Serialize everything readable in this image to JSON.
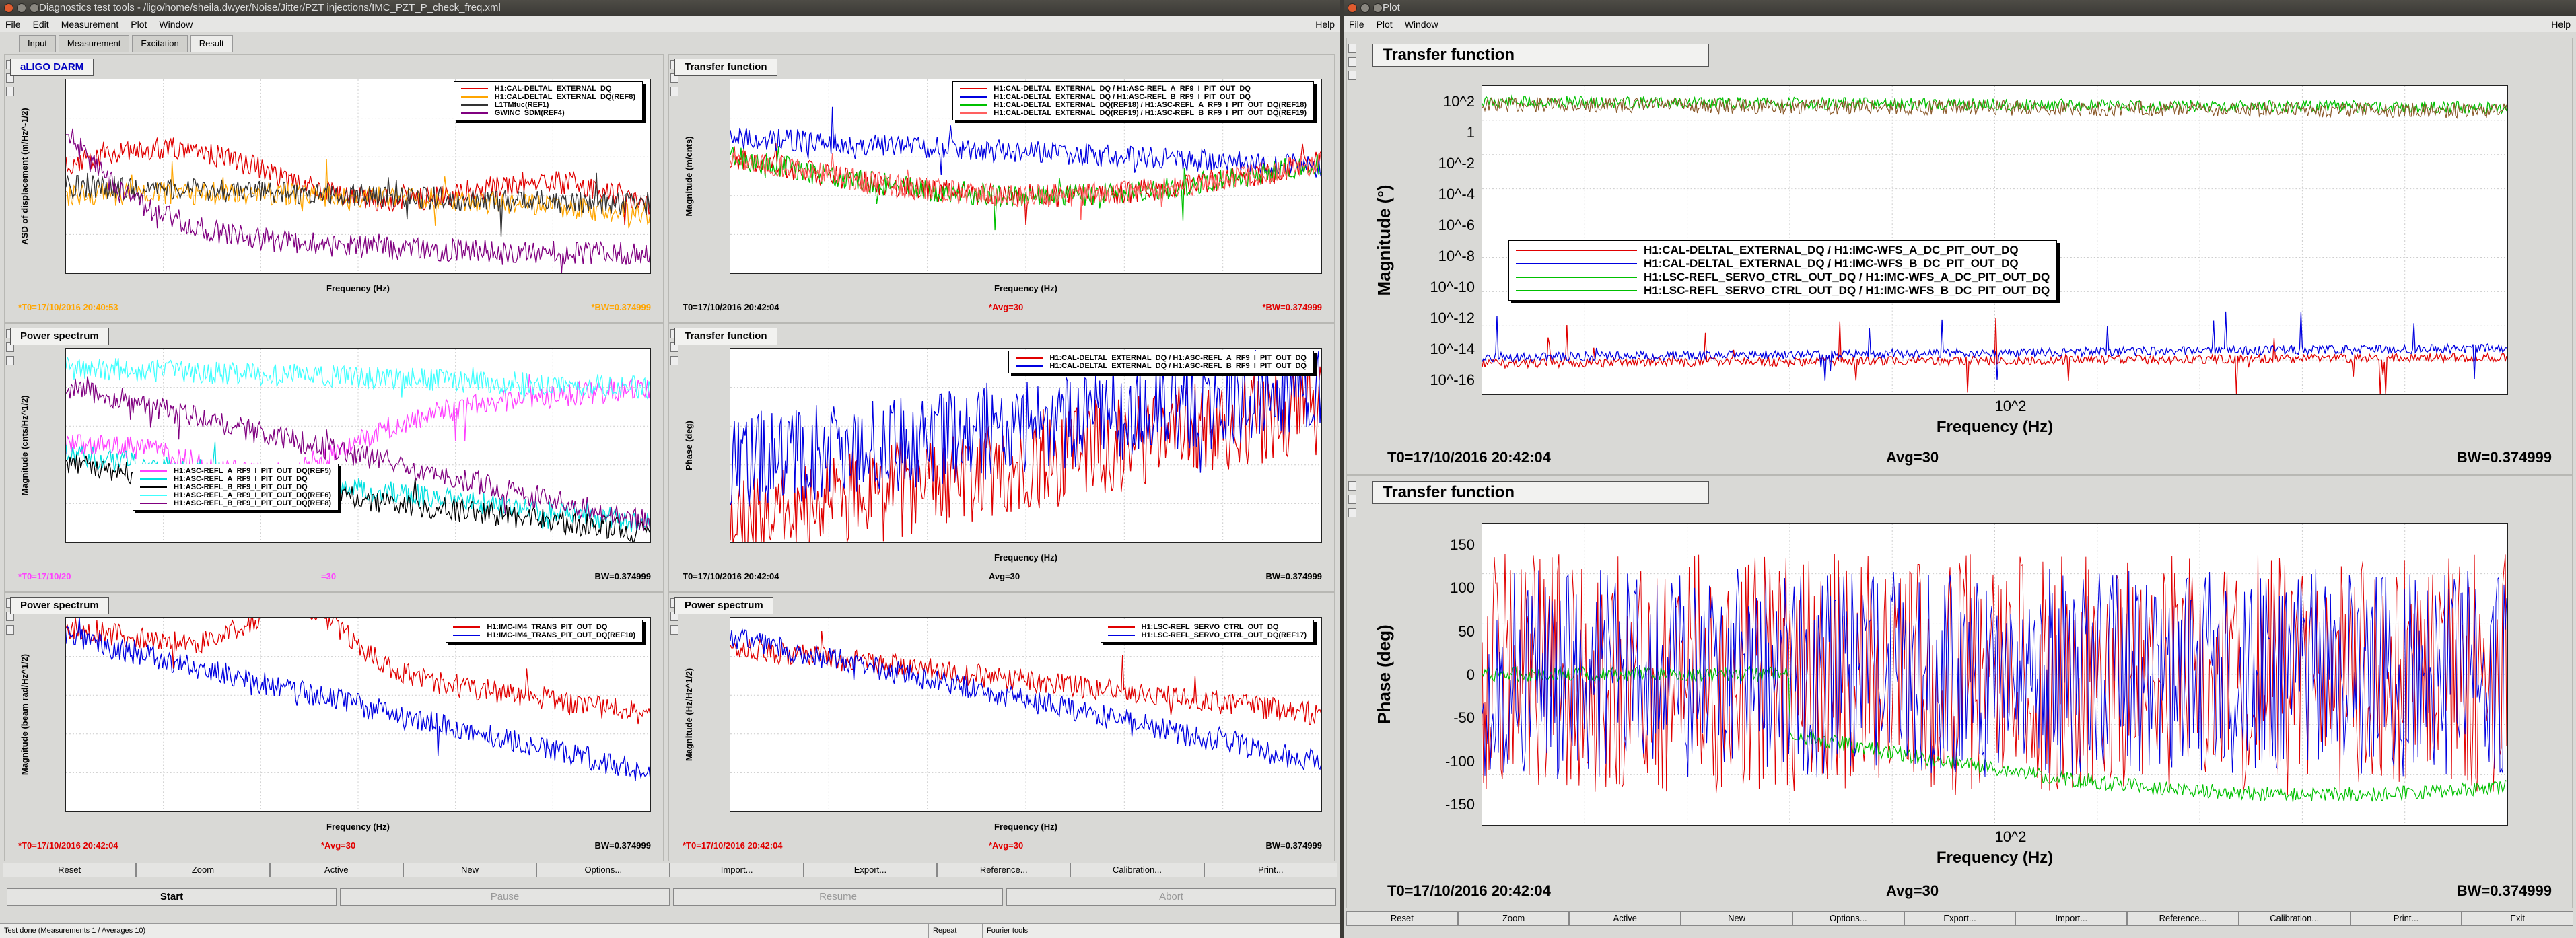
{
  "win1": {
    "title": "Diagnostics test tools - /ligo/home/sheila.dwyer/Noise/Jitter/PZT injections/IMC_PZT_P_check_freq.xml",
    "menus": [
      "File",
      "Edit",
      "Measurement",
      "Plot",
      "Window"
    ],
    "help": "Help",
    "tabs": [
      "Input",
      "Measurement",
      "Excitation",
      "Result"
    ],
    "panels": [
      {
        "title": "aLIGO DARM",
        "ylabel": "ASD of displacement (m/Hz^-1/2)",
        "xlabel": "Frequency (Hz)",
        "foot_left": "*T0=17/10/2016 20:40:53",
        "foot_mid": "",
        "foot_right": "*BW=0.374999",
        "legend": [
          {
            "label": "H1:CAL-DELTAL_EXTERNAL_DQ",
            "color": "#e00000"
          },
          {
            "label": "H1:CAL-DELTAL_EXTERNAL_DQ(REF8)",
            "color": "#ffa500"
          },
          {
            "label": "L1TMfuc(REF1)",
            "color": "#333333"
          },
          {
            "label": "GWINC_SDM(REF4)",
            "color": "#800080"
          }
        ]
      },
      {
        "title": "Transfer function",
        "ylabel": "Magnitude (m/cnts)",
        "xlabel": "Frequency (Hz)",
        "foot_left": "T0=17/10/2016 20:42:04",
        "foot_mid": "*Avg=30",
        "foot_right": "*BW=0.374999",
        "legend": [
          {
            "label": "H1:CAL-DELTAL_EXTERNAL_DQ / H1:ASC-REFL_A_RF9_I_PIT_OUT_DQ",
            "color": "#e00000"
          },
          {
            "label": "H1:CAL-DELTAL_EXTERNAL_DQ / H1:ASC-REFL_B_RF9_I_PIT_OUT_DQ",
            "color": "#0000e0"
          },
          {
            "label": "H1:CAL-DELTAL_EXTERNAL_DQ(REF18) / H1:ASC-REFL_A_RF9_I_PIT_OUT_DQ(REF18)",
            "color": "#00c000"
          },
          {
            "label": "H1:CAL-DELTAL_EXTERNAL_DQ(REF19) / H1:ASC-REFL_B_RF9_I_PIT_OUT_DQ(REF19)",
            "color": "#ff6060"
          }
        ]
      },
      {
        "title": "Power spectrum",
        "ylabel": "Magnitude (cnts/Hz^1/2)",
        "xlabel": "",
        "foot_left": "*T0=17/10/20",
        "foot_mid": "=30",
        "foot_right": "BW=0.374999",
        "legend": [
          {
            "label": "H1:ASC-REFL_A_RF9_I_PIT_OUT_DQ(REF5)",
            "color": "#ff40ff"
          },
          {
            "label": "H1:ASC-REFL_A_RF9_I_PIT_OUT_DQ",
            "color": "#00e0e0"
          },
          {
            "label": "H1:ASC-REFL_B_RF9_I_PIT_OUT_DQ",
            "color": "#000000"
          },
          {
            "label": "H1:ASC-REFL_A_RF9_I_PIT_OUT_DQ(REF6)",
            "color": "#40ffff"
          },
          {
            "label": "H1:ASC-REFL_B_RF9_I_PIT_OUT_DQ(REF8)",
            "color": "#800080"
          }
        ]
      },
      {
        "title": "Transfer function",
        "ylabel": "Phase (deg)",
        "xlabel": "Frequency (Hz)",
        "foot_left": "T0=17/10/2016 20:42:04",
        "foot_mid": "Avg=30",
        "foot_right": "BW=0.374999",
        "legend": [
          {
            "label": "H1:CAL-DELTAL_EXTERNAL_DQ / H1:ASC-REFL_A_RF9_I_PIT_OUT_DQ",
            "color": "#e00000"
          },
          {
            "label": "H1:CAL-DELTAL_EXTERNAL_DQ / H1:ASC-REFL_B_RF9_I_PIT_OUT_DQ",
            "color": "#0000e0"
          }
        ]
      },
      {
        "title": "Power spectrum",
        "ylabel": "Magnitude (beam rad/Hz^1/2)",
        "xlabel": "Frequency (Hz)",
        "foot_left": "*T0=17/10/2016 20:42:04",
        "foot_mid": "*Avg=30",
        "foot_right": "BW=0.374999",
        "legend": [
          {
            "label": "H1:IMC-IM4_TRANS_PIT_OUT_DQ",
            "color": "#e00000"
          },
          {
            "label": "H1:IMC-IM4_TRANS_PIT_OUT_DQ(REF10)",
            "color": "#0000e0"
          }
        ]
      },
      {
        "title": "Power spectrum",
        "ylabel": "Magnitude (Hz/Hz^1/2)",
        "xlabel": "Frequency (Hz)",
        "foot_left": "*T0=17/10/2016 20:42:04",
        "foot_mid": "*Avg=30",
        "foot_right": "BW=0.374999",
        "legend": [
          {
            "label": "H1:LSC-REFL_SERVO_CTRL_OUT_DQ",
            "color": "#e00000"
          },
          {
            "label": "H1:LSC-REFL_SERVO_CTRL_OUT_DQ(REF17)",
            "color": "#0000e0"
          }
        ]
      }
    ],
    "buttons": [
      "Reset",
      "Zoom",
      "Active",
      "New",
      "Options...",
      "Import...",
      "Export...",
      "Reference...",
      "Calibration...",
      "Print..."
    ],
    "bigbuttons": [
      "Start",
      "Pause",
      "Resume",
      "Abort"
    ],
    "status": [
      "Test done (Measurements 1 / Averages 10)",
      "",
      "Repeat",
      "Fourier tools"
    ]
  },
  "win2": {
    "title": "Plot",
    "menus": [
      "File",
      "Plot",
      "Window"
    ],
    "help": "Help",
    "panels": [
      {
        "title": "Transfer function",
        "ylabel": "Magnitude (°)",
        "xlabel": "Frequency (Hz)",
        "foot_left": "T0=17/10/2016 20:42:04",
        "foot_mid": "Avg=30",
        "foot_right": "BW=0.374999",
        "yticks": [
          "10^2",
          "1",
          "10^-2",
          "10^-4",
          "10^-6",
          "10^-8",
          "10^-10",
          "10^-12",
          "10^-14",
          "10^-16"
        ],
        "xtick": "10^2",
        "legend": [
          {
            "label": "H1:CAL-DELTAL_EXTERNAL_DQ / H1:IMC-WFS_A_DC_PIT_OUT_DQ",
            "color": "#e00000"
          },
          {
            "label": "H1:CAL-DELTAL_EXTERNAL_DQ / H1:IMC-WFS_B_DC_PIT_OUT_DQ",
            "color": "#0000e0"
          },
          {
            "label": "H1:LSC-REFL_SERVO_CTRL_OUT_DQ / H1:IMC-WFS_A_DC_PIT_OUT_DQ",
            "color": "#00c000"
          },
          {
            "label": "H1:LSC-REFL_SERVO_CTRL_OUT_DQ / H1:IMC-WFS_B_DC_PIT_OUT_DQ",
            "color": "#00c000"
          }
        ]
      },
      {
        "title": "Transfer function",
        "ylabel": "Phase (deg)",
        "xlabel": "Frequency (Hz)",
        "foot_left": "T0=17/10/2016 20:42:04",
        "foot_mid": "Avg=30",
        "foot_right": "BW=0.374999",
        "yticks": [
          "150",
          "100",
          "50",
          "0",
          "-50",
          "-100",
          "-150"
        ],
        "xtick": "10^2",
        "legend": []
      }
    ],
    "buttons": [
      "Reset",
      "Zoom",
      "Active",
      "New",
      "Options...",
      "Export...",
      "Import...",
      "Reference...",
      "Calibration...",
      "Print...",
      "Exit"
    ]
  },
  "colors": {
    "red": "#e00000",
    "blue": "#0000e0",
    "green": "#00c000",
    "orange": "#ffa500",
    "purple": "#800080",
    "magenta": "#ff40ff",
    "cyan": "#00e0e0",
    "brown": "#8b5a2b"
  }
}
